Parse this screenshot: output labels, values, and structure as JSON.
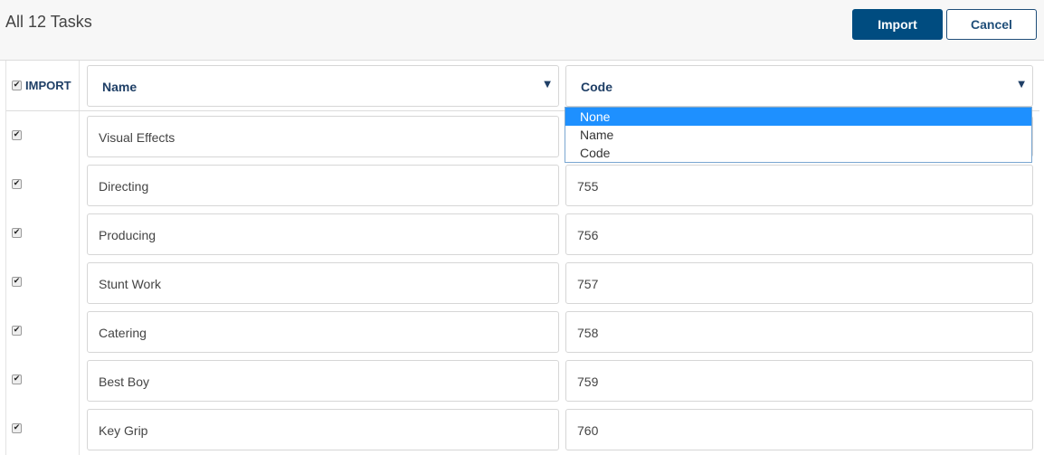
{
  "header": {
    "title": "All 12 Tasks",
    "import_button": "Import",
    "cancel_button": "Cancel"
  },
  "columns": {
    "import_label": "IMPORT",
    "import_checked": true,
    "name_select": "Name",
    "code_select": "Code"
  },
  "code_dropdown": {
    "options": [
      "None",
      "Name",
      "Code"
    ],
    "highlighted": "None"
  },
  "rows": [
    {
      "checked": true,
      "name": "Visual Effects",
      "code": ""
    },
    {
      "checked": true,
      "name": "Directing",
      "code": "755"
    },
    {
      "checked": true,
      "name": "Producing",
      "code": "756"
    },
    {
      "checked": true,
      "name": "Stunt Work",
      "code": "757"
    },
    {
      "checked": true,
      "name": "Catering",
      "code": "758"
    },
    {
      "checked": true,
      "name": "Best Boy",
      "code": "759"
    },
    {
      "checked": true,
      "name": "Key Grip",
      "code": "760"
    }
  ],
  "colors": {
    "primary": "#004c80",
    "link": "#1f4e79",
    "dropdown_highlight": "#1e90ff"
  },
  "icons": {
    "checkmark": "check-icon",
    "caret": "caret-down-icon"
  }
}
